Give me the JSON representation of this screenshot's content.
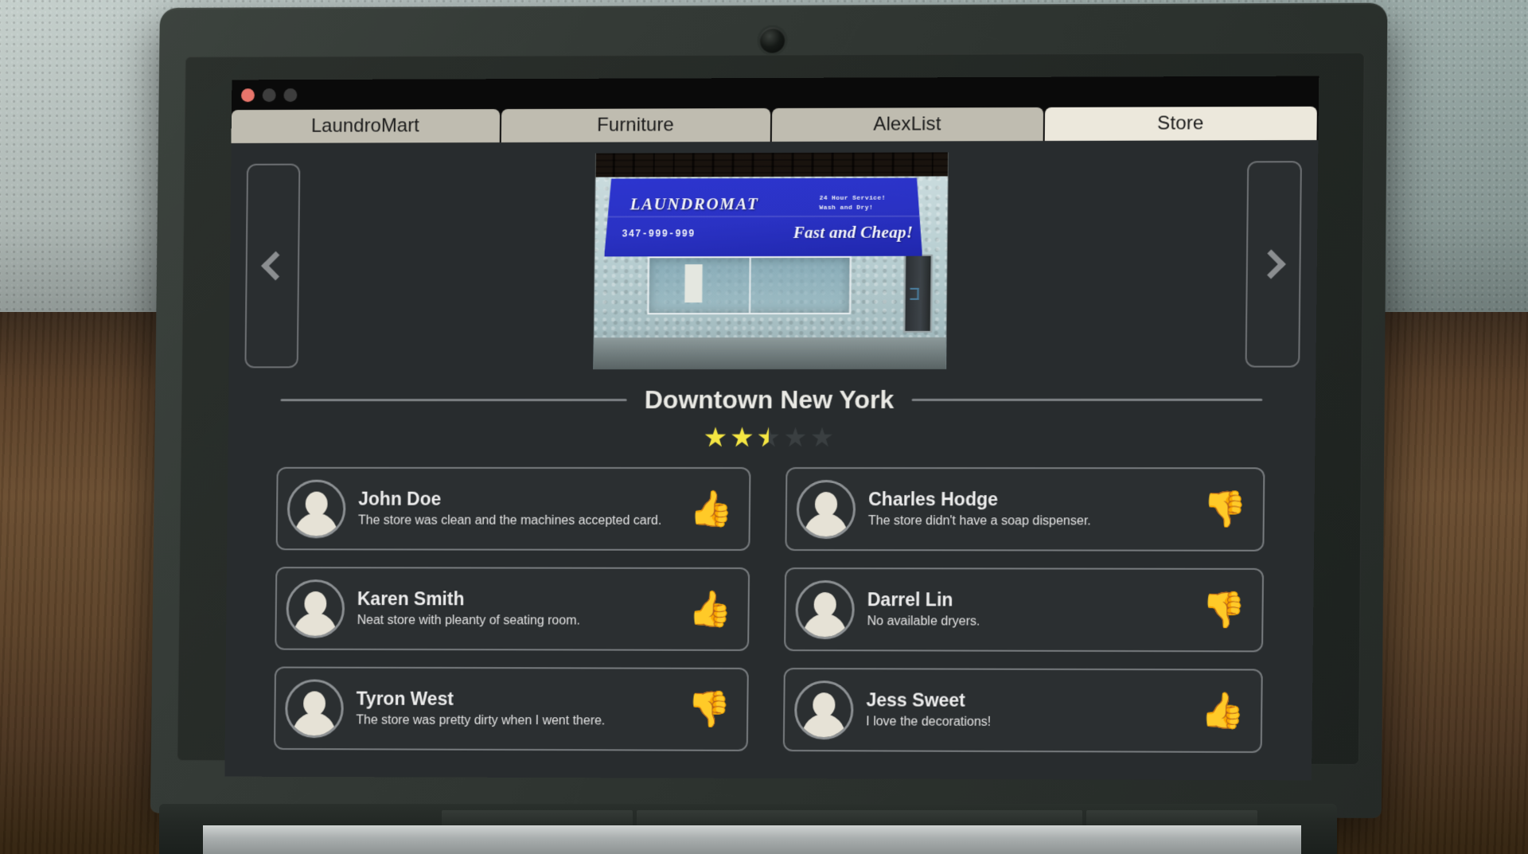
{
  "window": {
    "traffic_lights": [
      "close",
      "minimize",
      "maximize"
    ]
  },
  "tabs": [
    {
      "label": "LaundroMart",
      "active": false
    },
    {
      "label": "Furniture",
      "active": false
    },
    {
      "label": "AlexList",
      "active": false
    },
    {
      "label": "Store",
      "active": true
    }
  ],
  "carousel": {
    "prev_label": "‹",
    "next_label": "›",
    "storefront": {
      "sign_name": "LAUNDROMAT",
      "hours_line1": "24 Hour Service!",
      "hours_line2": "Wash and Dry!",
      "phone": "347-999-999",
      "tagline": "Fast and Cheap!"
    }
  },
  "store": {
    "title": "Downtown New York",
    "rating_value": 2.5,
    "rating_max": 5,
    "star_glyph": "★"
  },
  "reviews": [
    {
      "name": "John Doe",
      "text": "The store was clean and the machines accepted card.",
      "verdict": "up",
      "glyph": "👍"
    },
    {
      "name": "Charles Hodge",
      "text": "The store didn't have a soap dispenser.",
      "verdict": "down",
      "glyph": "👎"
    },
    {
      "name": "Karen Smith",
      "text": "Neat store with pleanty of seating room.",
      "verdict": "up",
      "glyph": "👍"
    },
    {
      "name": "Darrel Lin",
      "text": "No available dryers.",
      "verdict": "down",
      "glyph": "👎"
    },
    {
      "name": "Tyron West",
      "text": "The store was pretty dirty when I went there.",
      "verdict": "down",
      "glyph": "👎"
    },
    {
      "name": "Jess Sweet",
      "text": "I love the decorations!",
      "verdict": "up",
      "glyph": "👍"
    }
  ],
  "colors": {
    "thumb_up": "#4bf53e",
    "thumb_down": "#f40d0d",
    "star_filled": "#f5e642",
    "star_empty": "#3a3f41",
    "tab_active_bg": "#ece8dc",
    "tab_bg": "#bfbcb0",
    "screen_bg": "#282c2e"
  }
}
